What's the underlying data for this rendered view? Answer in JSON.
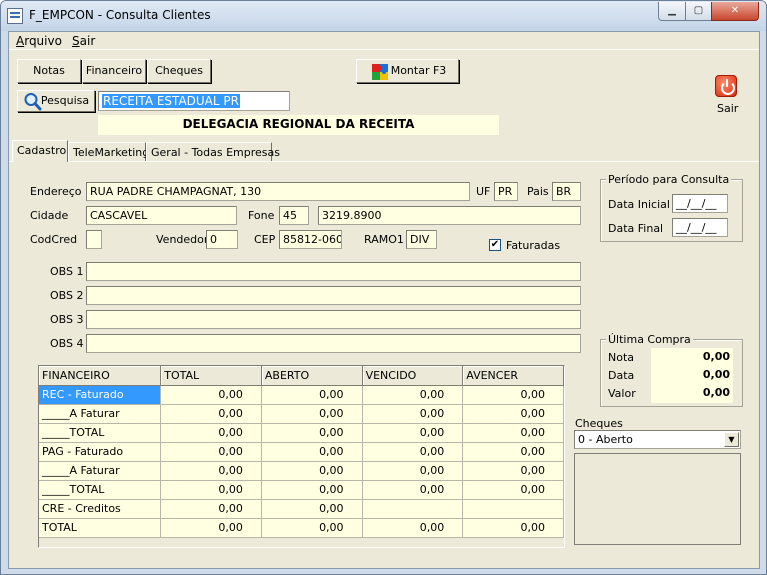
{
  "window": {
    "title": "F_EMPCON - Consulta Clientes",
    "min_glyph": "▁",
    "max_glyph": "▢",
    "close_glyph": "✕"
  },
  "menu": {
    "arquivo_first": "A",
    "arquivo_rest": "rquivo",
    "sair_first": "S",
    "sair_rest": "air"
  },
  "toolbar": {
    "notas": "Notas",
    "financeiro": "Financeiro",
    "cheques": "Cheques",
    "montar": "Montar F3",
    "pesquisa": "Pesquisa",
    "sair": "Sair"
  },
  "search": {
    "value": "RECEITA ESTADUAL PR"
  },
  "company_banner": "DELEGACIA REGIONAL DA RECEITA",
  "tabs": [
    "Cadastro",
    "TeleMarketing",
    "Geral - Todas Empresas"
  ],
  "form": {
    "endereco_label": "Endereço",
    "endereco": "RUA PADRE CHAMPAGNAT, 130",
    "uf_label": "UF",
    "uf": "PR",
    "pais_label": "Pais",
    "pais": "BR",
    "cidade_label": "Cidade",
    "cidade": "CASCAVEL",
    "fone_label": "Fone",
    "ddd": "45",
    "fone": "3219.8900",
    "codcred_label": "CodCred",
    "codcred": "",
    "vendedor_label": "Vendedor",
    "vendedor": "0",
    "cep_label": "CEP",
    "cep": "85812-060",
    "ramo_label": "RAMO1",
    "ramo": "DIV",
    "faturadas_label": "Faturadas",
    "faturadas_checked": true,
    "obs1_label": "OBS 1",
    "obs2_label": "OBS 2",
    "obs3_label": "OBS 3",
    "obs4_label": "OBS 4",
    "obs1": "",
    "obs2": "",
    "obs3": "",
    "obs4": ""
  },
  "periodo": {
    "title": "Período para Consulta",
    "inicial_label": "Data Inicial",
    "inicial": "__/__/__",
    "final_label": "Data Final",
    "final": "__/__/__"
  },
  "ultima_compra": {
    "title": "Última Compra",
    "nota_label": "Nota",
    "nota": "0,00",
    "data_label": "Data",
    "data": "0,00",
    "valor_label": "Valor",
    "valor": "0,00"
  },
  "cheques": {
    "label": "Cheques",
    "selected": "0 - Aberto",
    "arrow": "▼"
  },
  "grid": {
    "headers": [
      "FINANCEIRO",
      "TOTAL",
      "ABERTO",
      "VENCIDO",
      "AVENCER"
    ],
    "rows": [
      [
        "REC - Faturado",
        "0,00",
        "0,00",
        "0,00",
        "0,00"
      ],
      [
        "_____A Faturar",
        "0,00",
        "0,00",
        "0,00",
        "0,00"
      ],
      [
        "_____TOTAL",
        "0,00",
        "0,00",
        "0,00",
        "0,00"
      ],
      [
        "PAG - Faturado",
        "0,00",
        "0,00",
        "0,00",
        "0,00"
      ],
      [
        "_____A Faturar",
        "0,00",
        "0,00",
        "0,00",
        "0,00"
      ],
      [
        "_____TOTAL",
        "0,00",
        "0,00",
        "0,00",
        "0,00"
      ],
      [
        "CRE - Creditos",
        "0,00",
        "0,00",
        "",
        ""
      ],
      [
        "TOTAL",
        "0,00",
        "0,00",
        "0,00",
        "0,00"
      ]
    ]
  }
}
